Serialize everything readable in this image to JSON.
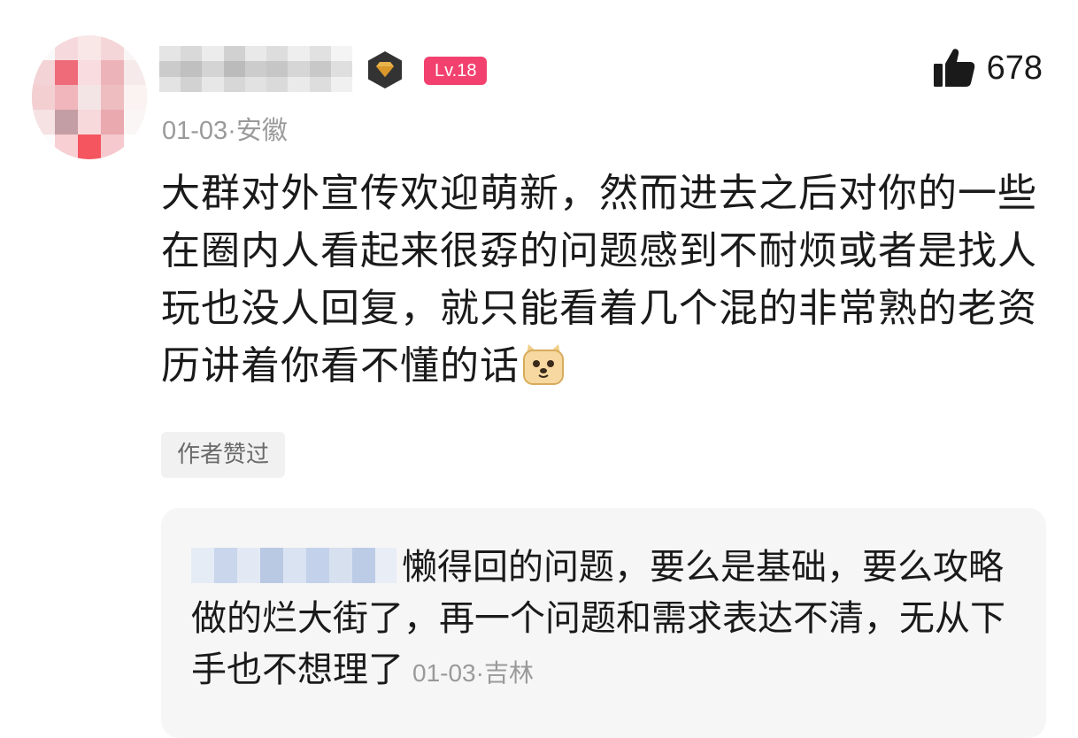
{
  "comment": {
    "like_count": "678",
    "level": "Lv.18",
    "meta": "01-03·安徽",
    "text": "大群对外宣传欢迎萌新，然而进去之后对你的一些在圈内人看起来很孬的问题感到不耐烦或者是找人玩也没人回复，就只能看着几个混的非常熟的老资历讲着你看不懂的话",
    "author_liked_label": "作者赞过",
    "emoji_name": "doge-emoji-icon"
  },
  "reply": {
    "text": "懒得回的问题，要么是基础，要么攻略做的烂大街了，再一个问题和需求表达不清，无从下手也不想理了",
    "meta": "01-03·吉林"
  },
  "colors": {
    "level_badge": "#f2416e",
    "meta_text": "#9a9a9a",
    "reply_bg": "#f6f6f6",
    "tag_bg": "#f1f1f1"
  }
}
